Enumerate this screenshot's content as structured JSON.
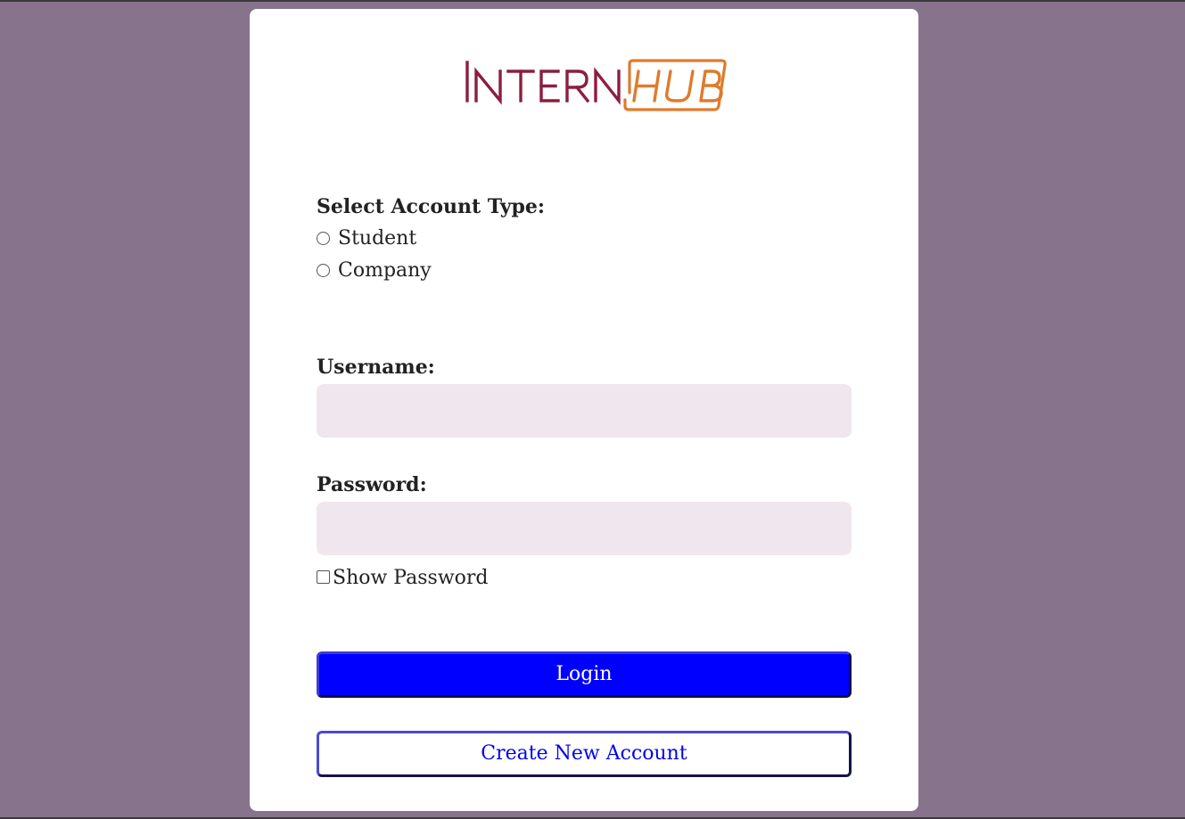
{
  "brand": {
    "logo_text_primary": "INTERN",
    "logo_text_secondary": "HUB",
    "primary_color": "#8b1e3f",
    "secondary_color": "#e07a2c"
  },
  "account_type": {
    "label": "Select Account Type:",
    "options": [
      "Student",
      "Company"
    ]
  },
  "username": {
    "label": "Username:",
    "value": "",
    "placeholder": ""
  },
  "password": {
    "label": "Password:",
    "value": "",
    "placeholder": ""
  },
  "show_password": {
    "label": "Show Password"
  },
  "buttons": {
    "login": "Login",
    "create_account": "Create New Account"
  },
  "colors": {
    "background": "#88738c",
    "card": "#ffffff",
    "input_bg": "#f0e6ee",
    "login_button": "#0000ff",
    "create_text": "#0000ee"
  }
}
